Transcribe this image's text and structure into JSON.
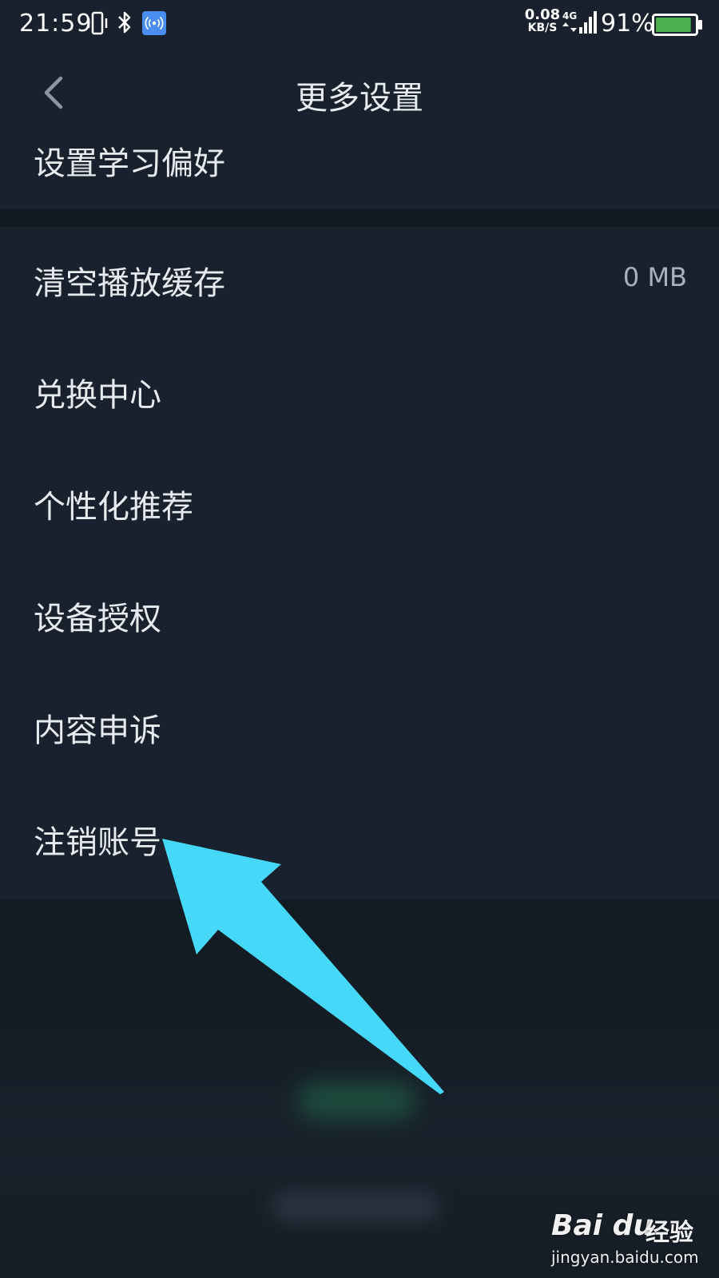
{
  "status_bar": {
    "time": "21:59",
    "net_speed_value": "0.08",
    "net_speed_unit": "KB/S",
    "network_type": "4G",
    "battery_percent": "91%",
    "battery_level": 0.91,
    "icons": [
      "vibrate-icon",
      "bluetooth-icon",
      "hotspot-icon",
      "signal-icon",
      "battery-icon"
    ]
  },
  "header": {
    "title": "更多设置",
    "back_icon": "chevron-left-icon"
  },
  "settings": {
    "top_item": {
      "label": "设置学习偏好"
    },
    "items": [
      {
        "label": "清空播放缓存",
        "value": "0 MB"
      },
      {
        "label": "兑换中心"
      },
      {
        "label": "个性化推荐"
      },
      {
        "label": "设备授权"
      },
      {
        "label": "内容申诉"
      },
      {
        "label": "注销账号"
      }
    ]
  },
  "annotation": {
    "arrow_color": "#45d8f8",
    "points_to": "注销账号"
  },
  "watermark": {
    "logo_text": "Bai du",
    "brand": "经验",
    "url": "jingyan.baidu.com"
  },
  "colors": {
    "background": "#18212d",
    "divider": "#111920",
    "text_primary": "#e7eaee",
    "text_secondary": "#a9b1bb",
    "hotspot_badge": "#4a8ff0",
    "battery_fill": "#4caf50"
  }
}
